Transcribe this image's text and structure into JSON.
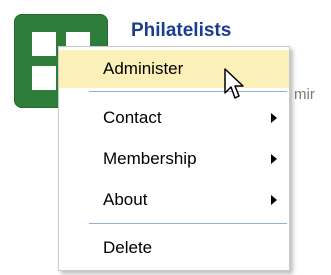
{
  "app": {
    "title": "Philatelists",
    "background_text": "mir"
  },
  "menu": {
    "items": [
      {
        "label": "Administer",
        "submenu": false,
        "hover": true
      },
      {
        "label": "Contact",
        "submenu": true
      },
      {
        "label": "Membership",
        "submenu": true
      },
      {
        "label": "About",
        "submenu": true
      },
      {
        "label": "Delete",
        "submenu": false
      }
    ]
  },
  "colors": {
    "icon_green": "#2e7d3a",
    "title_blue": "#1a3e8c",
    "hover_yellow": "#faf0b8",
    "separator_blue": "#8fb1d8"
  }
}
